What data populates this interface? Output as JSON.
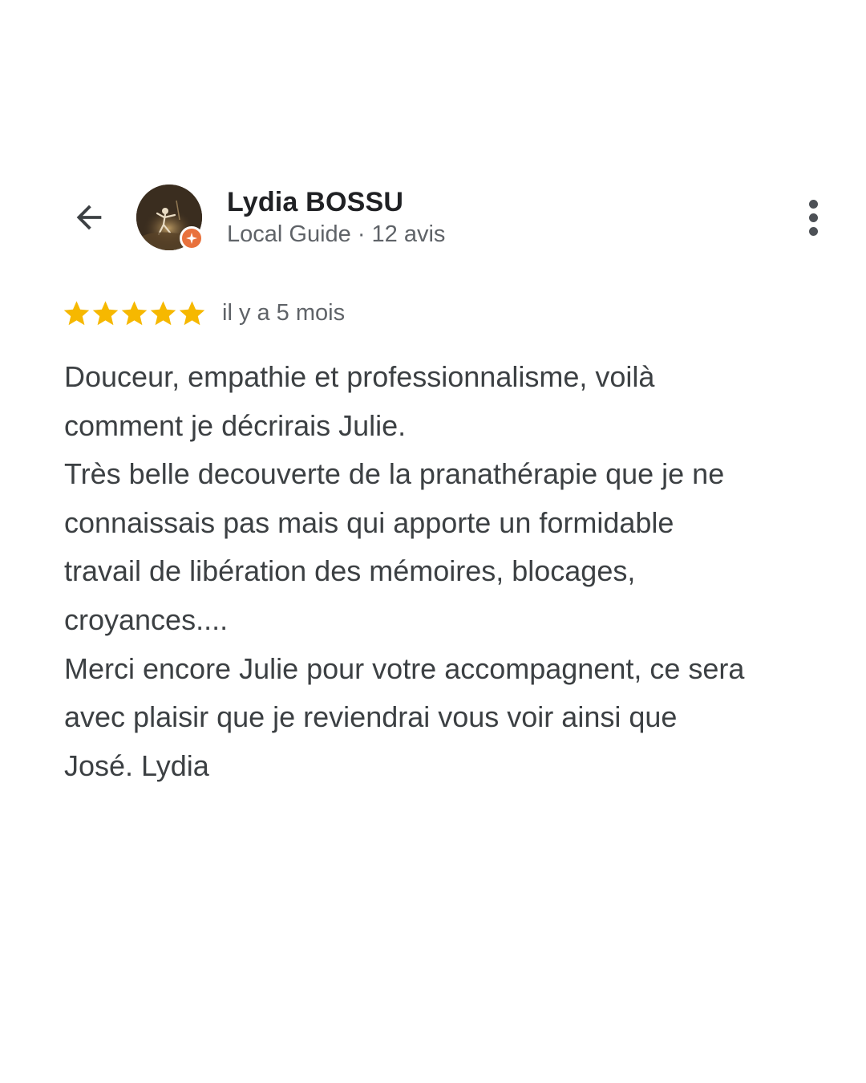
{
  "header": {
    "back_icon": "arrow-back-icon",
    "avatar_badge_icon": "local-guide-badge-icon",
    "reviewer_name": "Lydia BOSSU",
    "reviewer_meta": "Local Guide · 12 avis",
    "more_icon": "more-vert-icon"
  },
  "rating": {
    "stars": 5,
    "max_stars": 5,
    "star_color": "#f6b800",
    "date": "il y a 5 mois"
  },
  "review": {
    "lines": [
      "Douceur, empathie et professionnalisme, voilà",
      "comment je décrirais Julie.",
      "Très belle decouverte de la pranathérapie que je ne",
      "connaissais pas mais qui apporte un formidable",
      "travail de libération des mémoires, blocages,",
      "croyances....",
      "Merci encore Julie pour votre accompagnent, ce sera",
      "avec plaisir que je reviendrai vous voir ainsi que",
      "José. Lydia"
    ]
  },
  "colors": {
    "name": "#202124",
    "meta": "#5f6368",
    "body_text": "#3c4043",
    "badge": "#e8713c"
  }
}
